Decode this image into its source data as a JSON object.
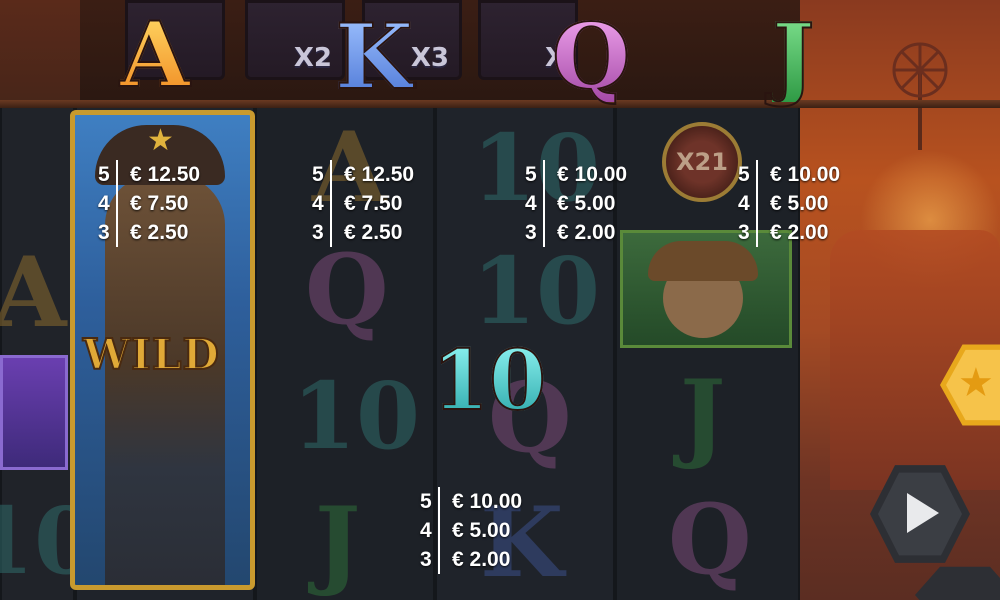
{
  "top_row": {
    "multipliers": [
      "X2",
      "X3",
      "X"
    ]
  },
  "symbols": {
    "ace": "A",
    "king": "K",
    "queen": "Q",
    "jack": "J",
    "ten": "10",
    "wild": "WILD"
  },
  "bonus_badge": "X21",
  "paytables": {
    "ace": {
      "counts": [
        "5",
        "4",
        "3"
      ],
      "values": [
        "€ 12.50",
        "€ 7.50",
        "€ 2.50"
      ]
    },
    "king": {
      "counts": [
        "5",
        "4",
        "3"
      ],
      "values": [
        "€ 12.50",
        "€ 7.50",
        "€ 2.50"
      ]
    },
    "queen": {
      "counts": [
        "5",
        "4",
        "3"
      ],
      "values": [
        "€ 10.00",
        "€ 5.00",
        "€ 2.00"
      ]
    },
    "jack": {
      "counts": [
        "5",
        "4",
        "3"
      ],
      "values": [
        "€ 10.00",
        "€ 5.00",
        "€ 2.00"
      ]
    },
    "ten": {
      "counts": [
        "5",
        "4",
        "3"
      ],
      "values": [
        "€ 10.00",
        "€ 5.00",
        "€ 2.00"
      ]
    }
  },
  "controls": {
    "feature_icon": "star-icon",
    "spin_icon": "play-icon"
  },
  "colors": {
    "ace": "#f3a435",
    "king": "#5b86e0",
    "queen": "#c463c6",
    "jack": "#36a54d",
    "ten": "#3fbfc0",
    "wild_frame": "#c99a2e",
    "feature_button": "#f6c34a"
  }
}
